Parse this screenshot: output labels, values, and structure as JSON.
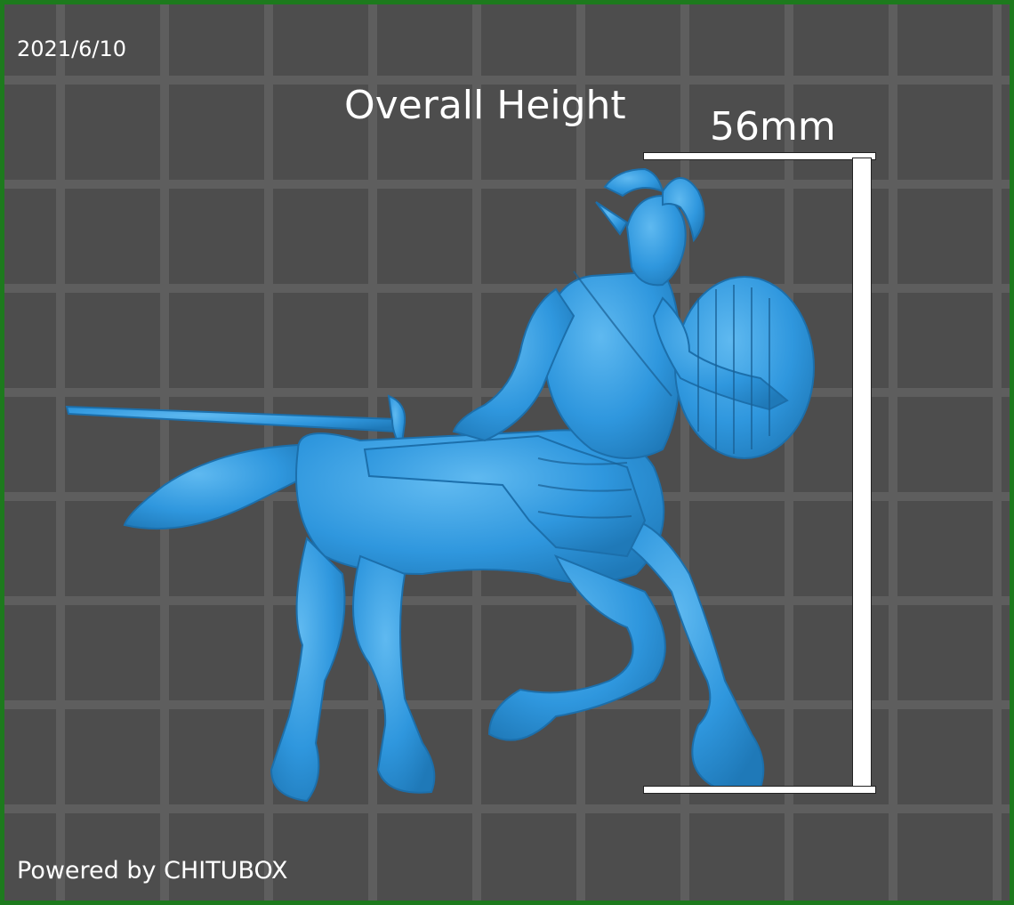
{
  "viewport": {
    "date": "2021/6/10",
    "powered_by": "Powered by CHITUBOX"
  },
  "measurement": {
    "title": "Overall Height",
    "value": "56mm"
  },
  "model": {
    "icon": "centaur-model-icon",
    "color": "#2f97de"
  },
  "colors": {
    "frame": "#1d7a1d",
    "background": "#4d4d4d",
    "grid": "#5e5e5e",
    "model": "#2f97de"
  }
}
